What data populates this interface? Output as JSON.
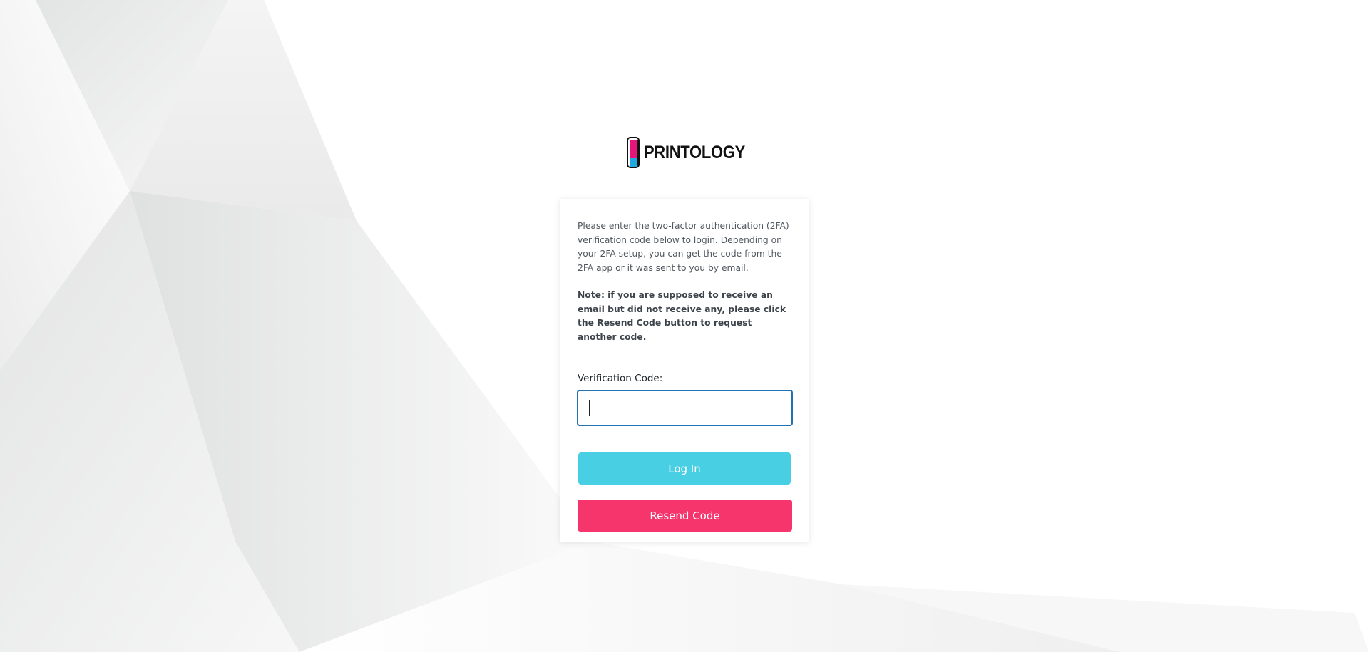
{
  "brand": {
    "name": "PRINTOLOGY",
    "logo_icon": "printology-logo-icon",
    "colors": {
      "magenta": "#e6157c",
      "cyan": "#1fa7e0",
      "yellow": "#ffe600",
      "black": "#111111"
    }
  },
  "twofa": {
    "intro": "Please enter the two-factor authentication (2FA) verification code below to login. Depending on your 2FA setup, you can get the code from the 2FA app or it was sent to you by email.",
    "note": "Note: if you are supposed to receive an email but did not receive any, please click the Resend Code button to request another code.",
    "code_label": "Verification Code:",
    "code_value": "",
    "code_placeholder": ""
  },
  "buttons": {
    "login_label": "Log In",
    "resend_label": "Resend Code",
    "login_color": "#48cfe3",
    "resend_color": "#f5356b"
  }
}
